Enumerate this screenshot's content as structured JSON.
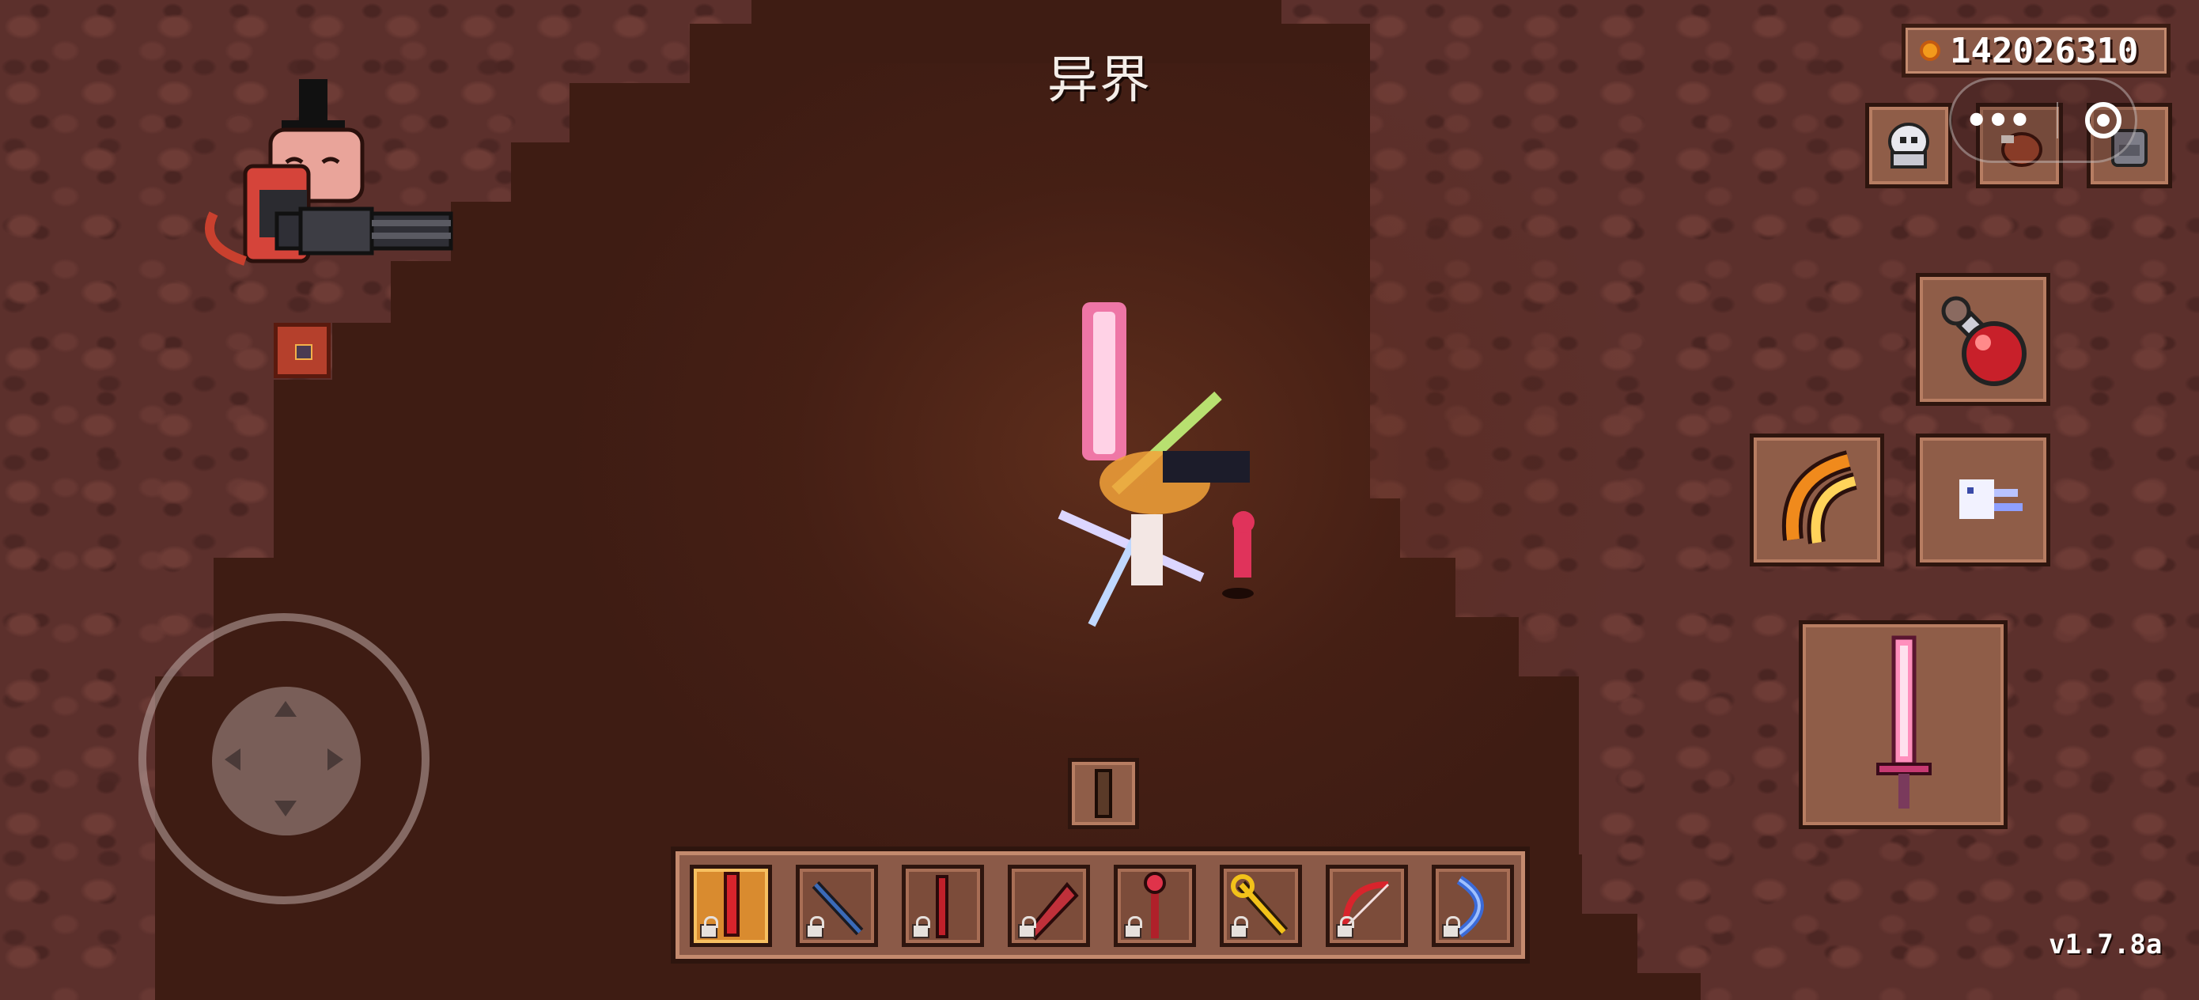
{
  "level": {
    "title": "异界"
  },
  "currency": {
    "icon": "gold-coin-icon",
    "amount": "142026310"
  },
  "top_buttons": [
    {
      "name": "ghost-armor-icon"
    },
    {
      "name": "meat-pet-icon"
    },
    {
      "name": "backpack-icon"
    }
  ],
  "system_capsule": {
    "menu_icon": "•••",
    "target_icon": "target-icon"
  },
  "skill_slots": [
    {
      "name": "health-potion-icon"
    },
    {
      "name": "fire-claw-icon"
    },
    {
      "name": "spirit-dash-icon"
    }
  ],
  "weapon": {
    "name": "pink-crystal-sword-icon"
  },
  "pickup_item": {
    "name": "wooden-plank-icon"
  },
  "hotbar": [
    {
      "name": "red-sword-icon",
      "locked": true,
      "active": true
    },
    {
      "name": "dark-hammer-icon",
      "locked": true,
      "active": false
    },
    {
      "name": "red-staff-icon",
      "locked": true,
      "active": false
    },
    {
      "name": "red-drill-icon",
      "locked": true,
      "active": false
    },
    {
      "name": "crimson-scepter-icon",
      "locked": true,
      "active": false
    },
    {
      "name": "golden-key-blade-icon",
      "locked": true,
      "active": false
    },
    {
      "name": "red-bow-icon",
      "locked": true,
      "active": false
    },
    {
      "name": "blue-crescent-bow-icon",
      "locked": true,
      "active": false
    }
  ],
  "version": "v1.7.8a",
  "colors": {
    "wall": "#5c302c",
    "floor": "#3e1c13",
    "panel": "#8b5a48",
    "panel_border": "#2e150e",
    "coin": "#f29a1c",
    "laser_pink": "#ff5fa2"
  }
}
